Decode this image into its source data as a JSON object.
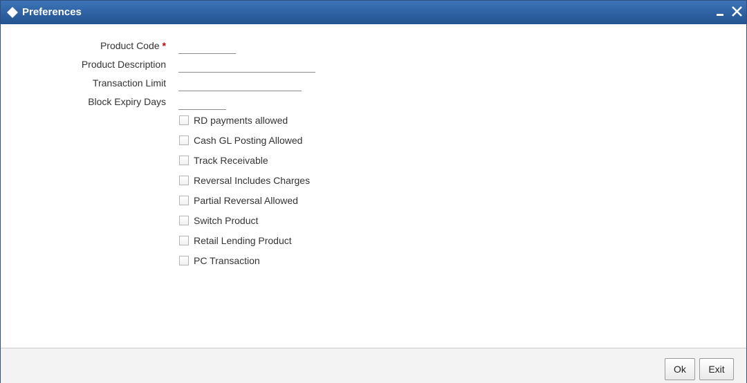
{
  "window": {
    "title": "Preferences",
    "minimize_icon": "minimize-icon",
    "close_icon": "close-icon",
    "title_icon": "diamond-icon",
    "title_bar_color": "#2c5fa0"
  },
  "form": {
    "product_code": {
      "label": "Product Code",
      "required_marker": "*",
      "value": ""
    },
    "product_description": {
      "label": "Product Description",
      "value": ""
    },
    "transaction_limit": {
      "label": "Transaction Limit",
      "value": ""
    },
    "block_expiry_days": {
      "label": "Block Expiry Days",
      "value": ""
    }
  },
  "checkboxes": [
    {
      "label": "RD payments allowed",
      "checked": false
    },
    {
      "label": "Cash GL Posting Allowed",
      "checked": false
    },
    {
      "label": "Track Receivable",
      "checked": false
    },
    {
      "label": "Reversal Includes Charges",
      "checked": false
    },
    {
      "label": "Partial Reversal Allowed",
      "checked": false
    },
    {
      "label": "Switch Product",
      "checked": false
    },
    {
      "label": "Retail Lending Product",
      "checked": false
    },
    {
      "label": "PC Transaction",
      "checked": false
    }
  ],
  "footer": {
    "ok_label": "Ok",
    "exit_label": "Exit"
  }
}
